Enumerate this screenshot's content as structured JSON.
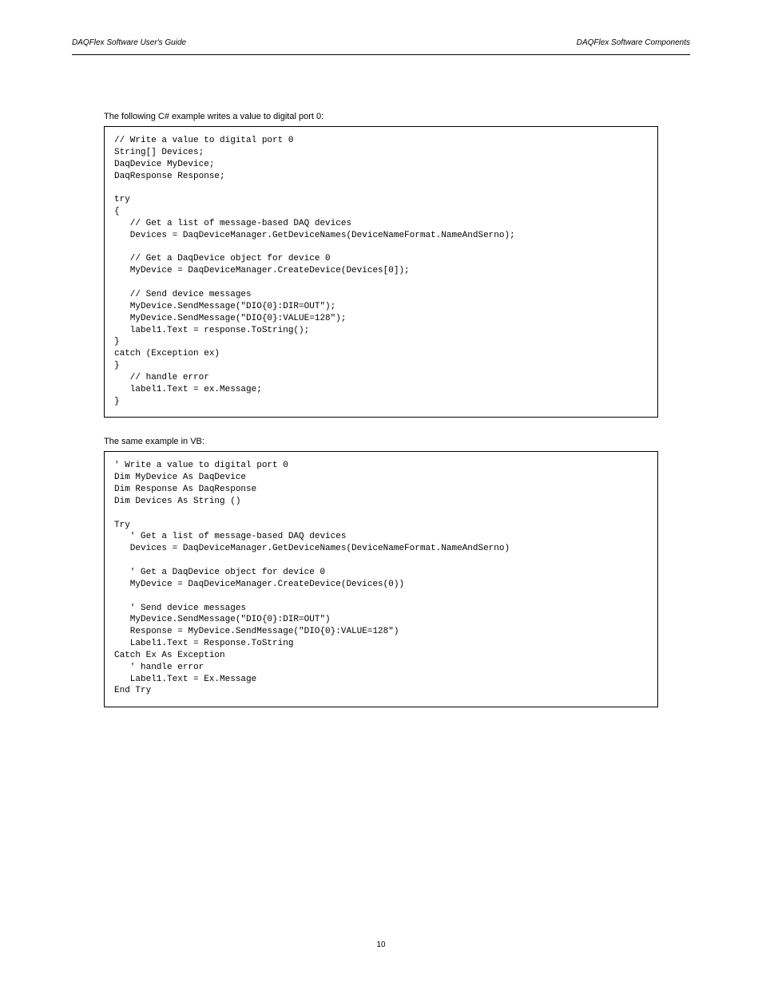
{
  "header": {
    "left": "DAQFlex Software User's Guide",
    "right": "DAQFlex Software Components"
  },
  "intro_csharp": "The following C# example writes a value to digital port 0:",
  "intro_vb": "The same example in VB:",
  "code_csharp": "// Write a value to digital port 0\nString[] Devices;\nDaqDevice MyDevice;\nDaqResponse Response;\n\ntry\n{\n   // Get a list of message-based DAQ devices\n   Devices = DaqDeviceManager.GetDeviceNames(DeviceNameFormat.NameAndSerno);\n\n   // Get a DaqDevice object for device 0\n   MyDevice = DaqDeviceManager.CreateDevice(Devices[0]);\n\n   // Send device messages\n   MyDevice.SendMessage(\"DIO{0}:DIR=OUT\");\n   MyDevice.SendMessage(\"DIO{0}:VALUE=128\");\n   label1.Text = response.ToString();\n}\ncatch (Exception ex)\n}\n   // handle error\n   label1.Text = ex.Message;\n}",
  "code_vb": "' Write a value to digital port 0\nDim MyDevice As DaqDevice\nDim Response As DaqResponse\nDim Devices As String ()\n\nTry\n   ' Get a list of message-based DAQ devices\n   Devices = DaqDeviceManager.GetDeviceNames(DeviceNameFormat.NameAndSerno)\n\n   ' Get a DaqDevice object for device 0\n   MyDevice = DaqDeviceManager.CreateDevice(Devices(0))\n\n   ' Send device messages\n   MyDevice.SendMessage(\"DIO{0}:DIR=OUT\")\n   Response = MyDevice.SendMessage(\"DIO{0}:VALUE=128\")\n   Label1.Text = Response.ToString\nCatch Ex As Exception\n   ' handle error\n   Label1.Text = Ex.Message\nEnd Try",
  "footer": "10"
}
